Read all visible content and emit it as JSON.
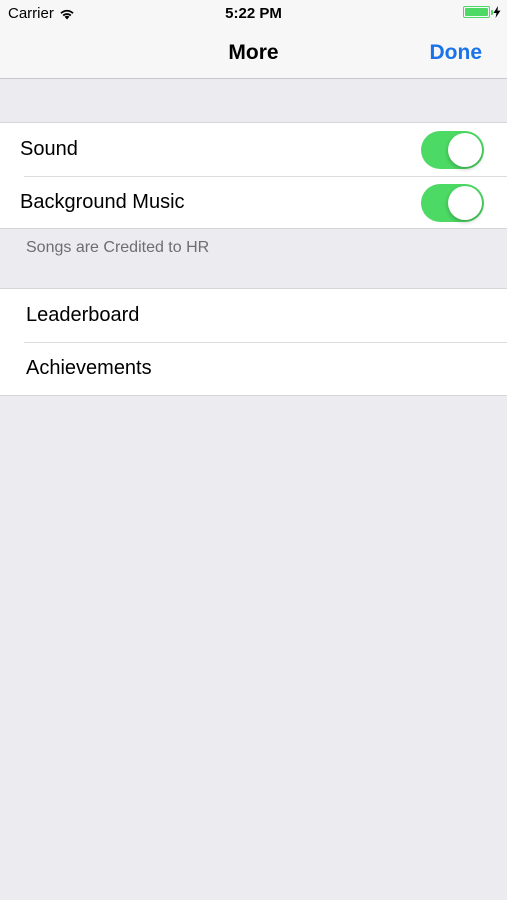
{
  "status_bar": {
    "carrier": "Carrier",
    "time": "5:22 PM",
    "battery_level": 1.0,
    "battery_color": "#4cd964"
  },
  "nav": {
    "title": "More",
    "done_label": "Done",
    "accent_color": "#1a73e8"
  },
  "settings": {
    "toggles": [
      {
        "label": "Sound",
        "on": true
      },
      {
        "label": "Background Music",
        "on": true
      }
    ],
    "footer_note": "Songs are Credited to HR"
  },
  "game_center": {
    "items": [
      {
        "label": "Leaderboard"
      },
      {
        "label": "Achievements"
      }
    ]
  },
  "colors": {
    "toggle_on": "#4cd964",
    "background": "#ebebf0"
  }
}
